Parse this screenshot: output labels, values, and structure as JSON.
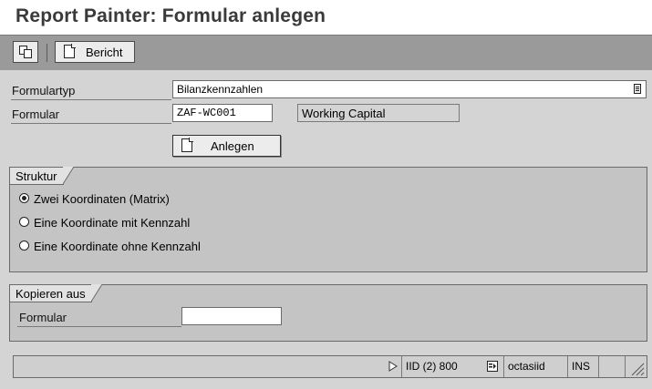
{
  "window": {
    "title": "Report Painter: Formular anlegen"
  },
  "toolbar": {
    "bericht_label": "Bericht"
  },
  "form": {
    "formulartyp_label": "Formulartyp",
    "formulartyp_value": "Bilanzkennzahlen",
    "formular_label": "Formular",
    "formular_value": "ZAF-WC001",
    "formular_description": "Working Capital",
    "anlegen_label": "Anlegen"
  },
  "struktur": {
    "title": "Struktur",
    "options": [
      {
        "label": "Zwei Koordinaten (Matrix)",
        "selected": true
      },
      {
        "label": "Eine Koordinate mit Kennzahl",
        "selected": false
      },
      {
        "label": "Eine Koordinate ohne Kennzahl",
        "selected": false
      }
    ]
  },
  "kopieren": {
    "title": "Kopieren aus",
    "formular_label": "Formular",
    "formular_value": ""
  },
  "statusbar": {
    "system": "IID (2) 800",
    "user": "octasiid",
    "mode": "INS"
  },
  "icons": [
    "copy-icon",
    "document-icon",
    "f4-help-icon",
    "play-triangle-icon",
    "session-icon",
    "resize-grip-icon"
  ]
}
